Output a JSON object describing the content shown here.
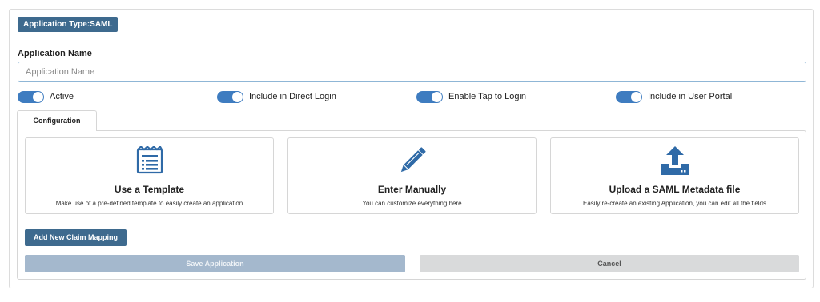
{
  "badge": {
    "label": "Application Type:SAML"
  },
  "app_name": {
    "label": "Application Name",
    "placeholder": "Application Name",
    "value": ""
  },
  "toggles": [
    {
      "label": "Active",
      "on": true
    },
    {
      "label": "Include in Direct Login",
      "on": true
    },
    {
      "label": "Enable Tap to Login",
      "on": true
    },
    {
      "label": "Include in User Portal",
      "on": true
    }
  ],
  "tabs": [
    {
      "label": "Configuration",
      "active": true
    }
  ],
  "cards": [
    {
      "icon": "template-icon",
      "title": "Use a Template",
      "description": "Make use of a pre-defined template to easily create an application"
    },
    {
      "icon": "pencil-icon",
      "title": "Enter Manually",
      "description": "You can customize everything here"
    },
    {
      "icon": "upload-icon",
      "title": "Upload a SAML Metadata file",
      "description": "Easily re-create an existing Application, you can edit all the fields"
    }
  ],
  "buttons": {
    "claim_mapping": "Add New Claim Mapping",
    "save": "Save Application",
    "cancel": "Cancel"
  },
  "colors": {
    "primary": "#3e6a8e",
    "toggle_on": "#3e7cc0",
    "icon": "#2f6aa7",
    "save_disabled": "#a4b8cd",
    "cancel_bg": "#d9dadb"
  }
}
